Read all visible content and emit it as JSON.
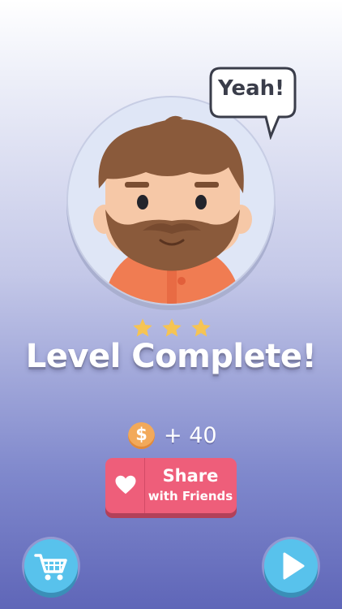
{
  "speech_bubble": {
    "text": "Yeah!"
  },
  "level": {
    "title": "Level Complete!",
    "stars": 3
  },
  "reward": {
    "coin_symbol": "$",
    "amount": "+ 40"
  },
  "share_button": {
    "line1": "Share",
    "line2": "with Friends"
  },
  "icons": [
    "heart-icon",
    "shopping-cart-icon",
    "play-icon",
    "coin-icon",
    "star-icon"
  ],
  "colors": {
    "share": "#ee5e7a",
    "round_buttons": "#58c2ec",
    "star": "#f6c453",
    "coin": "#f2a95a"
  }
}
